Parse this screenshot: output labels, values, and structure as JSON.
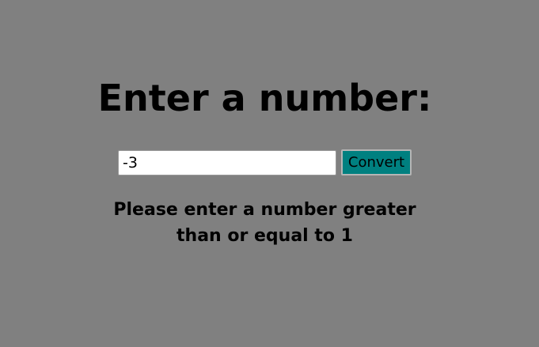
{
  "page": {
    "background": "#808080"
  },
  "heading": {
    "text": "Enter a number:"
  },
  "form": {
    "input_value": "-3",
    "convert_label": "Convert",
    "button_color": "#008080"
  },
  "message": {
    "text": "Please enter a number greater than or equal to 1"
  }
}
